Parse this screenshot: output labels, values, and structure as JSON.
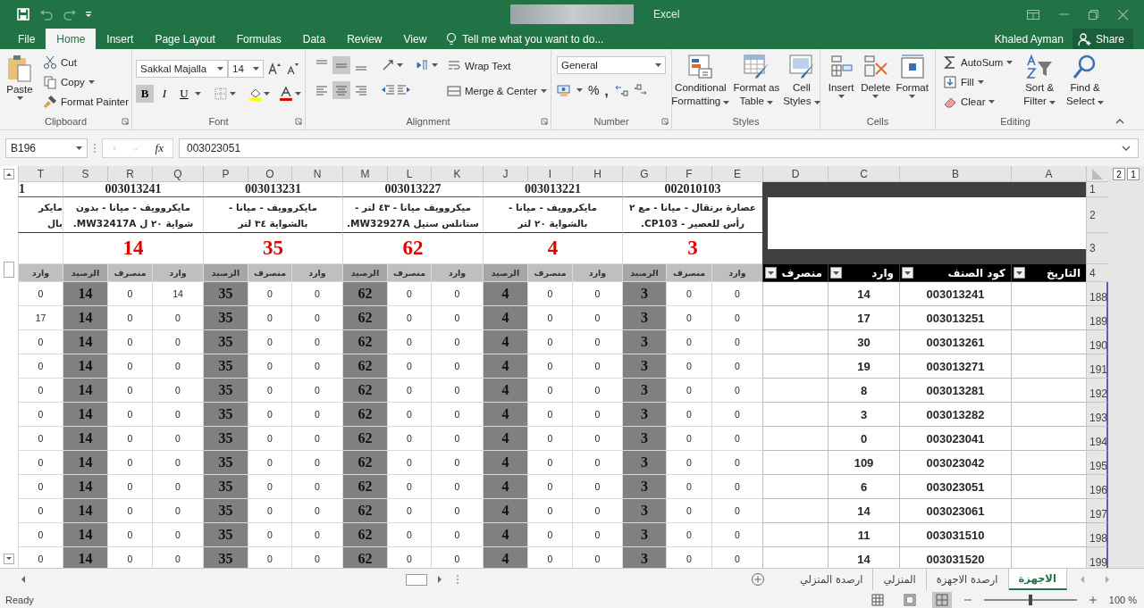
{
  "title_bar": {
    "app_name": "Excel"
  },
  "ribbon_tabs": [
    {
      "label": "View",
      "selected": false
    },
    {
      "label": "Review",
      "selected": false
    },
    {
      "label": "Data",
      "selected": false
    },
    {
      "label": "Formulas",
      "selected": false
    },
    {
      "label": "Page Layout",
      "selected": false
    },
    {
      "label": "Insert",
      "selected": false
    },
    {
      "label": "Home",
      "selected": true
    },
    {
      "label": "File",
      "selected": false
    }
  ],
  "tell_me": {
    "placeholder": "Tell me what you want to do..."
  },
  "user_name": "Khaled Ayman",
  "share_label": "Share",
  "clipboard": {
    "group": "Clipboard",
    "paste": "Paste",
    "cut": "Cut",
    "copy": "Copy",
    "format_painter": "Format Painter"
  },
  "font": {
    "group": "Font",
    "font_name": "Sakkal Majalla",
    "font_size": "14",
    "toggles": [
      {
        "label": "U",
        "on": false
      },
      {
        "label": "I",
        "on": false
      },
      {
        "label": "B",
        "on": true
      }
    ]
  },
  "alignment": {
    "group": "Alignment",
    "vertical_buttons": [
      {
        "kind": "top",
        "on": false
      },
      {
        "kind": "middle",
        "on": true
      },
      {
        "kind": "bottom",
        "on": false
      }
    ],
    "horizontal_buttons": [
      {
        "kind": "left",
        "on": false
      },
      {
        "kind": "center",
        "on": true
      },
      {
        "kind": "right",
        "on": false
      }
    ],
    "wrap_text": "Wrap Text",
    "merge": "Merge & Center"
  },
  "number": {
    "group": "Number",
    "format": "General",
    "percent": "%",
    "comma": ","
  },
  "styles": {
    "group": "Styles",
    "commands": [
      [
        "Cell",
        "Styles"
      ],
      [
        "Format as",
        "Table"
      ],
      [
        "Conditional",
        "Formatting"
      ]
    ]
  },
  "cells": {
    "group": "Cells",
    "commands": [
      "Format",
      "Delete",
      "Insert"
    ]
  },
  "editing": {
    "group": "Editing",
    "autosum": "AutoSum",
    "fill": "Fill",
    "clear": "Clear",
    "sort": [
      "Sort &",
      "Filter"
    ],
    "find": [
      "Find &",
      "Select"
    ]
  },
  "formula_bar": {
    "name_box": "B196",
    "fx": "fx",
    "value": "003023051"
  },
  "sheet": {
    "outline_levels": [
      "1",
      "2"
    ],
    "column_letters": [
      "A",
      "B",
      "C",
      "D",
      "E",
      "F",
      "G",
      "H",
      "I",
      "J",
      "K",
      "L",
      "M",
      "N",
      "O",
      "P",
      "Q",
      "R",
      "S",
      "T"
    ],
    "header_row_numbers": [
      "1",
      "2",
      "3",
      "4"
    ],
    "products": [
      {
        "code": "002010103",
        "description_lines": [
          "عصارة برتقال - ميانا - مع ٢",
          "رأس للعصير - CP103."
        ],
        "balance": "3"
      },
      {
        "code": "003013221",
        "description_lines": [
          "مايكروويف - ميانا -",
          "بالشواية ٢٠ لتر"
        ],
        "balance": "4"
      },
      {
        "code": "003013227",
        "description_lines": [
          "ميكروويف ميانا - ٤٣ لتر -",
          "ستانلس ستيل MW32927A."
        ],
        "balance": "62"
      },
      {
        "code": "003013231",
        "description_lines": [
          "مايكروويف - ميانا -",
          "بالشواية ٣٤ لتر"
        ],
        "balance": "35"
      },
      {
        "code": "003013241",
        "description_lines": [
          "مايكروويف - ميانا - بدون",
          "شواية ٢٠ ل MW32417A."
        ],
        "balance": "14"
      }
    ],
    "partial_product": {
      "code": "1",
      "description_lines": [
        "مايكر",
        "بال"
      ]
    },
    "table_headers": [
      "التاريخ",
      "كود الصنف",
      "وارد",
      "منصرف"
    ],
    "column_labels": [
      {
        "label": "وارد",
        "kind": "in"
      },
      {
        "label": "منصرف",
        "kind": "out"
      },
      {
        "label": "الرصيد",
        "kind": "balance"
      },
      {
        "label": "وارد",
        "kind": "in"
      },
      {
        "label": "منصرف",
        "kind": "out"
      },
      {
        "label": "الرصيد",
        "kind": "balance"
      },
      {
        "label": "وارد",
        "kind": "in"
      },
      {
        "label": "منصرف",
        "kind": "out"
      },
      {
        "label": "الرصيد",
        "kind": "balance"
      },
      {
        "label": "وارد",
        "kind": "in"
      },
      {
        "label": "منصرف",
        "kind": "out"
      },
      {
        "label": "الرصيد",
        "kind": "balance"
      },
      {
        "label": "وارد",
        "kind": "in"
      },
      {
        "label": "منصرف",
        "kind": "out"
      },
      {
        "label": "الرصيد",
        "kind": "balance"
      },
      {
        "label": "وارد",
        "kind": "in"
      }
    ],
    "rows": [
      {
        "number": "188",
        "code": "003013241",
        "in": "14",
        "values": [
          "0",
          "0",
          "3",
          "0",
          "0",
          "4",
          "0",
          "0",
          "62",
          "0",
          "0",
          "35",
          "14",
          "0",
          "14",
          "0"
        ]
      },
      {
        "number": "189",
        "code": "003013251",
        "in": "17",
        "values": [
          "0",
          "0",
          "3",
          "0",
          "0",
          "4",
          "0",
          "0",
          "62",
          "0",
          "0",
          "35",
          "0",
          "0",
          "14",
          "17"
        ]
      },
      {
        "number": "190",
        "code": "003013261",
        "in": "30",
        "values": [
          "0",
          "0",
          "3",
          "0",
          "0",
          "4",
          "0",
          "0",
          "62",
          "0",
          "0",
          "35",
          "0",
          "0",
          "14",
          "0"
        ]
      },
      {
        "number": "191",
        "code": "003013271",
        "in": "19",
        "values": [
          "0",
          "0",
          "3",
          "0",
          "0",
          "4",
          "0",
          "0",
          "62",
          "0",
          "0",
          "35",
          "0",
          "0",
          "14",
          "0"
        ]
      },
      {
        "number": "192",
        "code": "003013281",
        "in": "8",
        "values": [
          "0",
          "0",
          "3",
          "0",
          "0",
          "4",
          "0",
          "0",
          "62",
          "0",
          "0",
          "35",
          "0",
          "0",
          "14",
          "0"
        ]
      },
      {
        "number": "193",
        "code": "003013282",
        "in": "3",
        "values": [
          "0",
          "0",
          "3",
          "0",
          "0",
          "4",
          "0",
          "0",
          "62",
          "0",
          "0",
          "35",
          "0",
          "0",
          "14",
          "0"
        ]
      },
      {
        "number": "194",
        "code": "003023041",
        "in": "0",
        "values": [
          "0",
          "0",
          "3",
          "0",
          "0",
          "4",
          "0",
          "0",
          "62",
          "0",
          "0",
          "35",
          "0",
          "0",
          "14",
          "0"
        ]
      },
      {
        "number": "195",
        "code": "003023042",
        "in": "109",
        "values": [
          "0",
          "0",
          "3",
          "0",
          "0",
          "4",
          "0",
          "0",
          "62",
          "0",
          "0",
          "35",
          "0",
          "0",
          "14",
          "0"
        ]
      },
      {
        "number": "196",
        "code": "003023051",
        "in": "6",
        "values": [
          "0",
          "0",
          "3",
          "0",
          "0",
          "4",
          "0",
          "0",
          "62",
          "0",
          "0",
          "35",
          "0",
          "0",
          "14",
          "0"
        ]
      },
      {
        "number": "197",
        "code": "003023061",
        "in": "14",
        "values": [
          "0",
          "0",
          "3",
          "0",
          "0",
          "4",
          "0",
          "0",
          "62",
          "0",
          "0",
          "35",
          "0",
          "0",
          "14",
          "0"
        ]
      },
      {
        "number": "198",
        "code": "003031510",
        "in": "11",
        "values": [
          "0",
          "0",
          "3",
          "0",
          "0",
          "4",
          "0",
          "0",
          "62",
          "0",
          "0",
          "35",
          "0",
          "0",
          "14",
          "0"
        ]
      },
      {
        "number": "199",
        "code": "003031520",
        "in": "14",
        "values": [
          "0",
          "0",
          "3",
          "0",
          "0",
          "4",
          "0",
          "0",
          "62",
          "0",
          "0",
          "35",
          "0",
          "0",
          "14",
          "0"
        ]
      }
    ]
  },
  "sheet_tabs": [
    {
      "label": "الاجهزة",
      "selected": true
    },
    {
      "label": "ارصدة الاجهزة",
      "selected": false
    },
    {
      "label": "المنزلي",
      "selected": false
    },
    {
      "label": "ارصدة المنزلي",
      "selected": false
    }
  ],
  "status_bar": {
    "status": "Ready",
    "zoom": {
      "label": "100 %",
      "level": 0.5
    }
  }
}
